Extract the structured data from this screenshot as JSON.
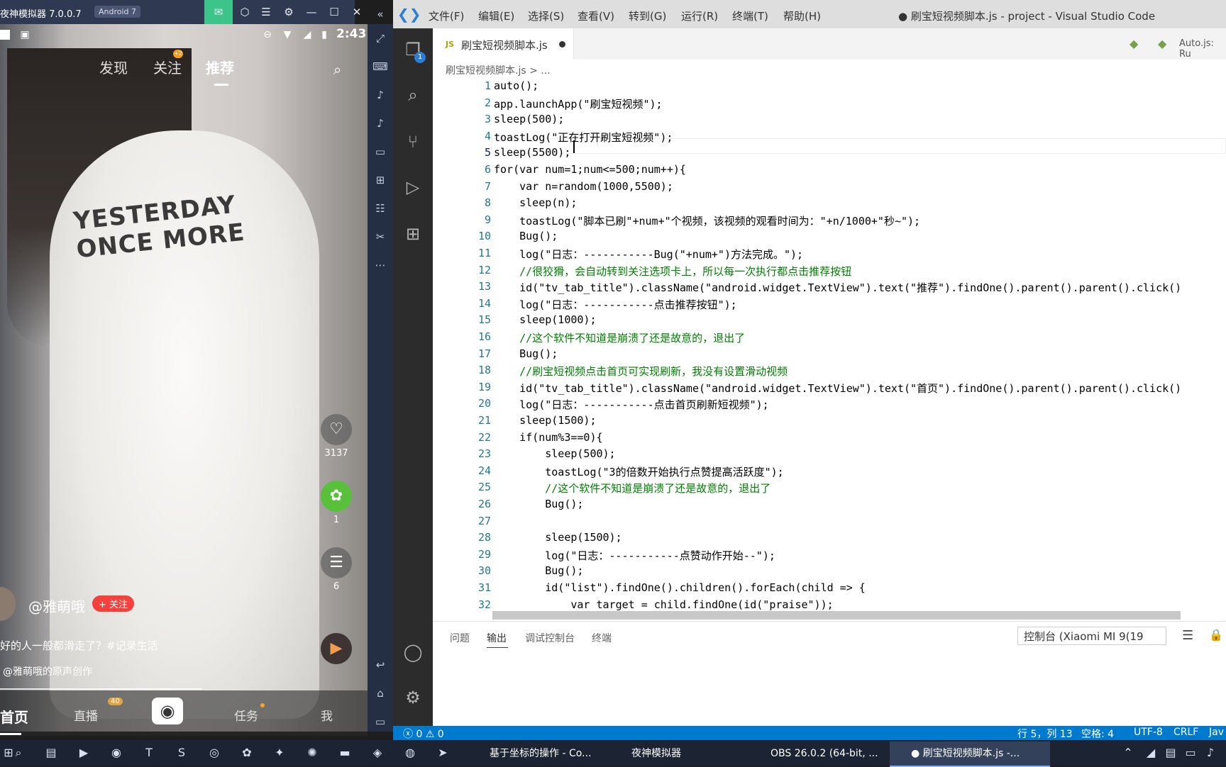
{
  "emulator": {
    "title": "夜神模拟器 7.0.0.7",
    "badge": "Android 7",
    "controls": [
      "mail-icon",
      "box-icon",
      "menu-icon",
      "gear-icon",
      "minimize-icon",
      "maximize-icon",
      "close-icon",
      "collapse-icon"
    ],
    "status_time": "2:43",
    "top_tabs": [
      "发现",
      "关注",
      "推荐"
    ],
    "follow_dot": "+2",
    "like_count": "3137",
    "share_count": "1",
    "comment_count": "6",
    "author": "@雅萌哦",
    "follow_button": "+ 关注",
    "caption": "好的人一般都滑走了？#记录生活",
    "sound": "@雅萌哦的原声创作",
    "shirt_text": "YESTERDAY ONCE MORE",
    "bottom_nav": [
      "首页",
      "直播",
      "任务",
      "我"
    ],
    "live_badge": "40"
  },
  "vscode": {
    "menu": [
      "文件(F)",
      "编辑(E)",
      "选择(S)",
      "查看(V)",
      "转到(G)",
      "运行(R)",
      "终端(T)",
      "帮助(H)"
    ],
    "window_title": "● 刷宝短视频脚本.js - project - Visual Studio Code",
    "tab_label": "刷宝短视频脚本.js",
    "tab_lang": "JS",
    "breadcrumb": "刷宝短视频脚本.js > ...",
    "autojs_label": "Auto.js: Ru",
    "explorer_badge": "1",
    "code_lines": [
      "auto();",
      "app.launchApp(\"刷宝短视频\");",
      "sleep(500);",
      "toastLog(\"正在打开刷宝短视频\");",
      "sleep(5500);",
      "for(var num=1;num<=500;num++){",
      "    var n=random(1000,5500);",
      "    sleep(n);",
      "    toastLog(\"脚本已刷\"+num+\"个视频，该视频的观看时间为：\"+n/1000+\"秒~\");",
      "    Bug();",
      "    log(\"日志：-----------Bug(\"+num+\")方法完成。\");",
      "    //很狡猾，会自动转到关注选项卡上，所以每一次执行都点击推荐按钮",
      "    id(\"tv_tab_title\").className(\"android.widget.TextView\").text(\"推荐\").findOne().parent().parent().click()",
      "    log(\"日志：-----------点击推荐按钮\");",
      "    sleep(1000);",
      "    //这个软件不知道是崩溃了还是故意的，退出了",
      "    Bug();",
      "    //刷宝短视频点击首页可实现刷新，我没有设置滑动视频",
      "    id(\"tv_tab_title\").className(\"android.widget.TextView\").text(\"首页\").findOne().parent().parent().click()",
      "    log(\"日志：-----------点击首页刷新短视频\");",
      "    sleep(1500);",
      "    if(num%3==0){",
      "        sleep(500);",
      "        toastLog(\"3的倍数开始执行点赞提高活跃度\");",
      "        //这个软件不知道是崩溃了还是故意的，退出了",
      "        Bug();",
      "",
      "        sleep(1500);",
      "        log(\"日志：-----------点赞动作开始--\");",
      "        Bug();",
      "        id(\"list\").findOne().children().forEach(child => {",
      "            var target = child.findOne(id(\"praise\"));"
    ],
    "panel_tabs": [
      "问题",
      "输出",
      "调试控制台",
      "终端"
    ],
    "console_select": "控制台 (Xiaomi MI 9(19",
    "status": {
      "errors": "ⓧ 0 ⚠ 0",
      "position": "行 5，列 13",
      "spaces": "空格: 4",
      "encoding": "UTF-8",
      "eol": "CRLF",
      "lang": "Jav"
    }
  },
  "taskbar": {
    "apps": [
      "基于坐标的操作 - Co...",
      "夜神模拟器",
      "OBS 26.0.2 (64-bit, ...",
      "● 刷宝短视频脚本.js -..."
    ]
  },
  "colors": {
    "accent": "#007acc",
    "emu_bar": "#2f3a52",
    "taskbar": "#1c2433"
  }
}
